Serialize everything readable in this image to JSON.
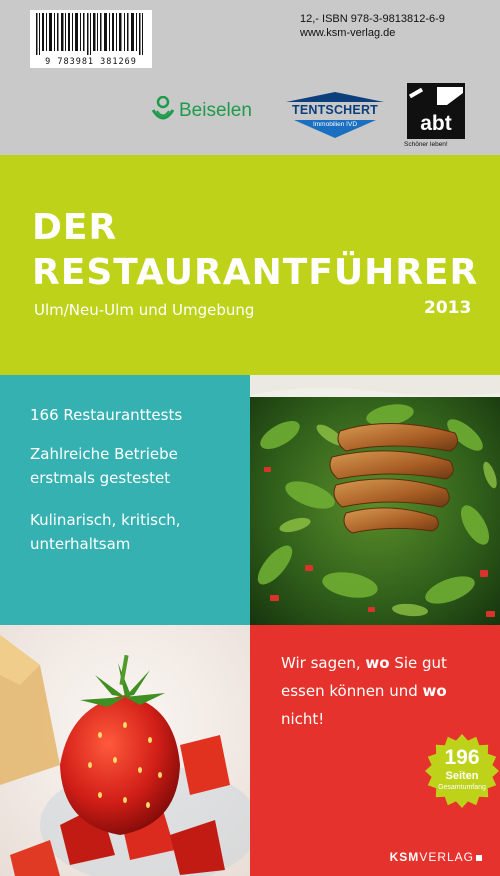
{
  "back_info": {
    "barcode_number": "9 783981 381269",
    "price_isbn": "12,-  ISBN 978-3-9813812-6-9",
    "website": "www.ksm-verlag.de"
  },
  "sponsors": {
    "beiselen": "Beiselen",
    "tentschert_name": "TENTSCHERT",
    "tentschert_sub": "Immobilien IVD",
    "abt_name": "abt",
    "abt_tagline": "Schöner leben!"
  },
  "title": {
    "line1": "DER",
    "line2": "RESTAURANTFÜHRER",
    "subtitle": "Ulm/Neu-Ulm und Umgebung",
    "year": "2013"
  },
  "features": [
    "166 Restauranttests",
    "Zahlreiche Betriebe erstmals gestestet",
    "Kulinarisch, kritisch, unterhaltsam"
  ],
  "slogan": {
    "part1": "Wir sagen, ",
    "bold1": "wo",
    "part2": " Sie gut essen können und ",
    "bold2": "wo",
    "part3": " nicht!"
  },
  "seal": {
    "number": "196",
    "label": "Seiten",
    "sub": "Gesamtumfang"
  },
  "publisher": {
    "bold": "KSM",
    "rest": "VERLAG"
  },
  "colors": {
    "top_band": "#c9c9c9",
    "title_band": "#bed21a",
    "teal": "#36b1b2",
    "red": "#e6322c",
    "seal": "#bed21a"
  }
}
